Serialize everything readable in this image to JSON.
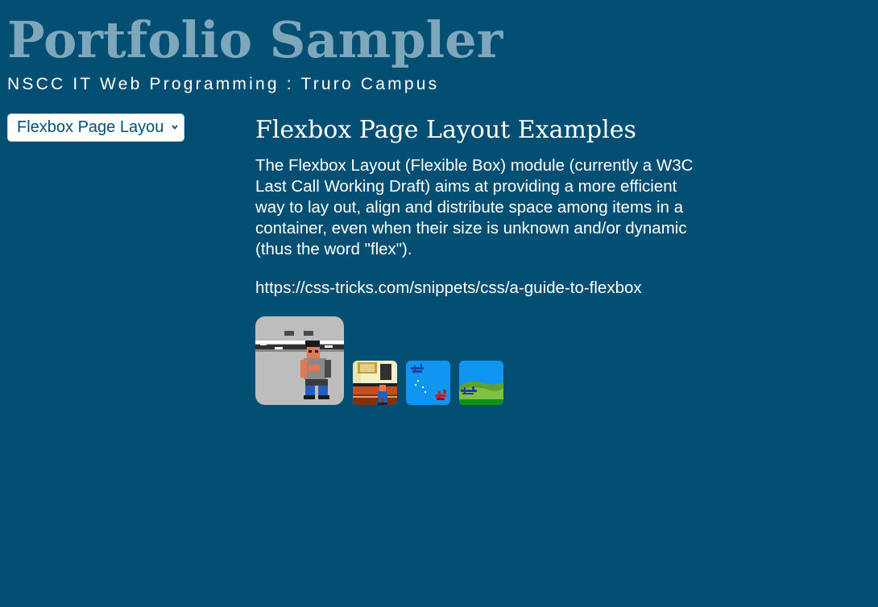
{
  "header": {
    "title": "Portfolio Sampler",
    "subtitle": "NSCC IT Web Programming : Truro Campus"
  },
  "nav": {
    "page_select": {
      "selected": "Flexbox Page Layout Examples",
      "icon": "chevron-down-icon"
    }
  },
  "main": {
    "heading": "Flexbox Page Layout Examples",
    "paragraph": "The Flexbox Layout (Flexible Box) module (currently a W3C Last Call Working Draft) aims at providing a more efficient way to lay out, align and distribute space among items in a container, even when their size is unknown and/or dynamic (thus the word \"flex\").",
    "link": "https://css-tricks.com/snippets/css/a-guide-to-flexbox"
  },
  "gallery": {
    "images": [
      {
        "name": "pixel-brawler-large",
        "size": "large"
      },
      {
        "name": "pixel-room-thumb",
        "size": "small"
      },
      {
        "name": "pixel-biplanes-sky-thumb",
        "size": "small"
      },
      {
        "name": "pixel-biplane-hills-thumb",
        "size": "small"
      }
    ]
  },
  "colors": {
    "background": "#034f73",
    "title": "#7fa7bb",
    "text": "#ffffff",
    "select_text": "#034f73"
  }
}
